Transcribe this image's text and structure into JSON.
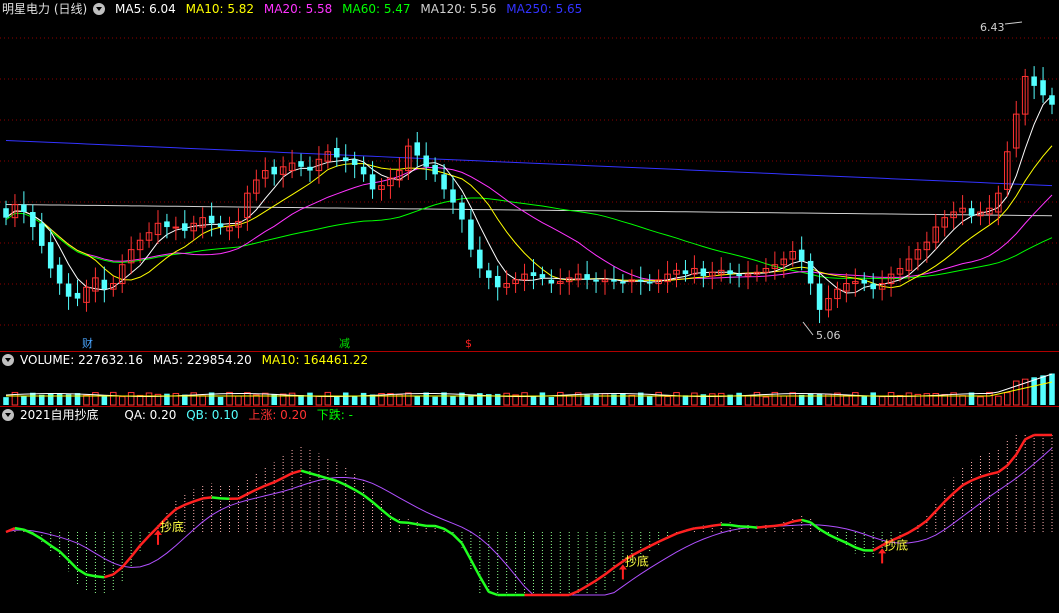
{
  "main_panel": {
    "title": "明星电力 (日线)",
    "ma": [
      {
        "label": "MA5: 6.04",
        "color": "#ffffff"
      },
      {
        "label": "MA10: 5.82",
        "color": "#ffff00"
      },
      {
        "label": "MA20: 5.58",
        "color": "#ff33ff"
      },
      {
        "label": "MA60: 5.47",
        "color": "#00ff00"
      },
      {
        "label": "MA120: 5.56",
        "color": "#d0d0d0"
      },
      {
        "label": "MA250: 5.65",
        "color": "#3333ff"
      }
    ],
    "high_label": "6.43",
    "low_label": "5.06",
    "markers": [
      {
        "text": "财",
        "color": "#4aa6ff"
      },
      {
        "text": "减",
        "color": "#00e000"
      },
      {
        "text": "$",
        "color": "#ff2020"
      }
    ]
  },
  "volume_panel": {
    "title": "VOLUME: 227632.16",
    "ma5": "MA5: 229854.20",
    "ma10": "MA10: 164461.22"
  },
  "indicator_panel": {
    "title": "2021自用抄底",
    "qa": "QA: 0.20",
    "qb": "QB: 0.10",
    "up": "上涨: 0.20",
    "down": "下跌: -",
    "signal_label": "抄底"
  },
  "colors": {
    "up": "#ff3232",
    "down": "#54ffff",
    "bg": "#000000",
    "grid": "#8b0000"
  },
  "chart_data": {
    "type": "candlestick",
    "title": "明星电力 (日线)",
    "price_max": 6.43,
    "price_min": 5.06,
    "closes": [
      5.55,
      5.62,
      5.58,
      5.5,
      5.4,
      5.28,
      5.2,
      5.13,
      5.12,
      5.18,
      5.23,
      5.17,
      5.2,
      5.3,
      5.38,
      5.43,
      5.47,
      5.52,
      5.5,
      5.5,
      5.48,
      5.52,
      5.55,
      5.52,
      5.5,
      5.5,
      5.53,
      5.68,
      5.75,
      5.8,
      5.78,
      5.82,
      5.84,
      5.82,
      5.8,
      5.86,
      5.9,
      5.87,
      5.85,
      5.83,
      5.78,
      5.7,
      5.72,
      5.76,
      5.8,
      5.93,
      5.88,
      5.82,
      5.78,
      5.7,
      5.63,
      5.54,
      5.38,
      5.28,
      5.23,
      5.18,
      5.2,
      5.22,
      5.25,
      5.24,
      5.23,
      5.2,
      5.21,
      5.23,
      5.25,
      5.22,
      5.21,
      5.22,
      5.21,
      5.2,
      5.22,
      5.21,
      5.2,
      5.22,
      5.25,
      5.27,
      5.25,
      5.28,
      5.24,
      5.26,
      5.27,
      5.25,
      5.24,
      5.25,
      5.26,
      5.28,
      5.3,
      5.33,
      5.37,
      5.32,
      5.2,
      5.06,
      5.12,
      5.17,
      5.2,
      5.21,
      5.2,
      5.17,
      5.2,
      5.25,
      5.28,
      5.33,
      5.38,
      5.42,
      5.5,
      5.55,
      5.58,
      5.6,
      5.56,
      5.58,
      5.6,
      5.68,
      5.9,
      6.1,
      6.3,
      6.25,
      6.2,
      6.15
    ],
    "opens": [
      5.6,
      5.55,
      5.62,
      5.58,
      5.52,
      5.42,
      5.3,
      5.2,
      5.15,
      5.1,
      5.16,
      5.22,
      5.17,
      5.2,
      5.31,
      5.38,
      5.43,
      5.46,
      5.53,
      5.5,
      5.52,
      5.48,
      5.5,
      5.56,
      5.52,
      5.48,
      5.5,
      5.55,
      5.68,
      5.76,
      5.82,
      5.78,
      5.8,
      5.85,
      5.82,
      5.8,
      5.85,
      5.92,
      5.87,
      5.86,
      5.82,
      5.78,
      5.7,
      5.72,
      5.75,
      5.8,
      5.95,
      5.88,
      5.83,
      5.78,
      5.7,
      5.63,
      5.54,
      5.38,
      5.27,
      5.24,
      5.18,
      5.2,
      5.22,
      5.26,
      5.25,
      5.22,
      5.2,
      5.21,
      5.22,
      5.25,
      5.22,
      5.21,
      5.22,
      5.21,
      5.21,
      5.22,
      5.21,
      5.2,
      5.21,
      5.25,
      5.27,
      5.25,
      5.28,
      5.24,
      5.25,
      5.27,
      5.25,
      5.24,
      5.25,
      5.26,
      5.28,
      5.3,
      5.33,
      5.38,
      5.32,
      5.2,
      5.06,
      5.12,
      5.16,
      5.2,
      5.22,
      5.2,
      5.17,
      5.2,
      5.25,
      5.27,
      5.33,
      5.38,
      5.42,
      5.5,
      5.55,
      5.58,
      5.6,
      5.56,
      5.57,
      5.58,
      5.7,
      5.92,
      6.1,
      6.3,
      6.28,
      6.2
    ]
  }
}
